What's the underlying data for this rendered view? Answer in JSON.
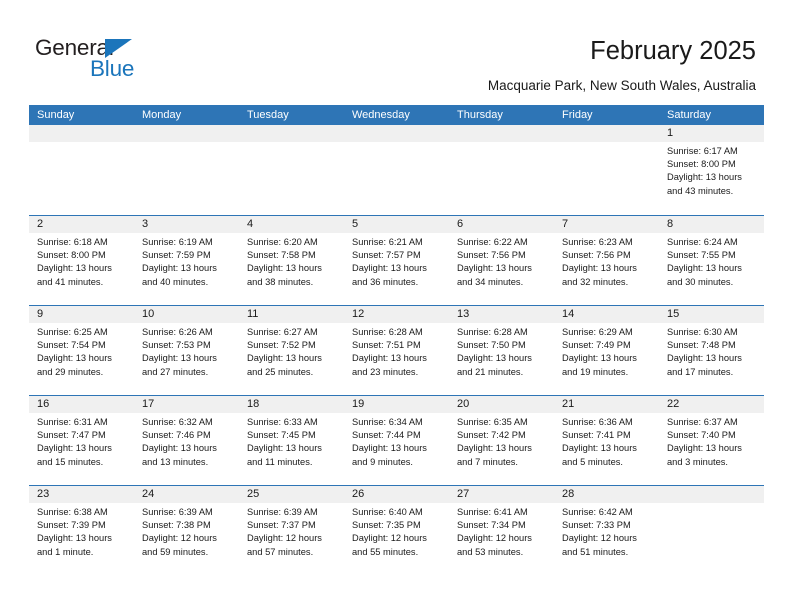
{
  "brand": {
    "name_top": "General",
    "name_bottom": "Blue",
    "triangle_color": "#1b75bb"
  },
  "header": {
    "title": "February 2025",
    "subtitle": "Macquarie Park, New South Wales, Australia"
  },
  "theme": {
    "header_blue": "#2e75b6",
    "band_gray": "#f0f0f0",
    "text": "#1a1a1a"
  },
  "weekdays": [
    "Sunday",
    "Monday",
    "Tuesday",
    "Wednesday",
    "Thursday",
    "Friday",
    "Saturday"
  ],
  "labels": {
    "sunrise": "Sunrise:",
    "sunset": "Sunset:",
    "daylight": "Daylight:"
  },
  "weeks": [
    [
      {
        "day": "",
        "empty": true
      },
      {
        "day": "",
        "empty": true
      },
      {
        "day": "",
        "empty": true
      },
      {
        "day": "",
        "empty": true
      },
      {
        "day": "",
        "empty": true
      },
      {
        "day": "",
        "empty": true
      },
      {
        "day": "1",
        "sunrise": "Sunrise: 6:17 AM",
        "sunset": "Sunset: 8:00 PM",
        "daylight": "Daylight: 13 hours and 43 minutes."
      }
    ],
    [
      {
        "day": "2",
        "sunrise": "Sunrise: 6:18 AM",
        "sunset": "Sunset: 8:00 PM",
        "daylight": "Daylight: 13 hours and 41 minutes."
      },
      {
        "day": "3",
        "sunrise": "Sunrise: 6:19 AM",
        "sunset": "Sunset: 7:59 PM",
        "daylight": "Daylight: 13 hours and 40 minutes."
      },
      {
        "day": "4",
        "sunrise": "Sunrise: 6:20 AM",
        "sunset": "Sunset: 7:58 PM",
        "daylight": "Daylight: 13 hours and 38 minutes."
      },
      {
        "day": "5",
        "sunrise": "Sunrise: 6:21 AM",
        "sunset": "Sunset: 7:57 PM",
        "daylight": "Daylight: 13 hours and 36 minutes."
      },
      {
        "day": "6",
        "sunrise": "Sunrise: 6:22 AM",
        "sunset": "Sunset: 7:56 PM",
        "daylight": "Daylight: 13 hours and 34 minutes."
      },
      {
        "day": "7",
        "sunrise": "Sunrise: 6:23 AM",
        "sunset": "Sunset: 7:56 PM",
        "daylight": "Daylight: 13 hours and 32 minutes."
      },
      {
        "day": "8",
        "sunrise": "Sunrise: 6:24 AM",
        "sunset": "Sunset: 7:55 PM",
        "daylight": "Daylight: 13 hours and 30 minutes."
      }
    ],
    [
      {
        "day": "9",
        "sunrise": "Sunrise: 6:25 AM",
        "sunset": "Sunset: 7:54 PM",
        "daylight": "Daylight: 13 hours and 29 minutes."
      },
      {
        "day": "10",
        "sunrise": "Sunrise: 6:26 AM",
        "sunset": "Sunset: 7:53 PM",
        "daylight": "Daylight: 13 hours and 27 minutes."
      },
      {
        "day": "11",
        "sunrise": "Sunrise: 6:27 AM",
        "sunset": "Sunset: 7:52 PM",
        "daylight": "Daylight: 13 hours and 25 minutes."
      },
      {
        "day": "12",
        "sunrise": "Sunrise: 6:28 AM",
        "sunset": "Sunset: 7:51 PM",
        "daylight": "Daylight: 13 hours and 23 minutes."
      },
      {
        "day": "13",
        "sunrise": "Sunrise: 6:28 AM",
        "sunset": "Sunset: 7:50 PM",
        "daylight": "Daylight: 13 hours and 21 minutes."
      },
      {
        "day": "14",
        "sunrise": "Sunrise: 6:29 AM",
        "sunset": "Sunset: 7:49 PM",
        "daylight": "Daylight: 13 hours and 19 minutes."
      },
      {
        "day": "15",
        "sunrise": "Sunrise: 6:30 AM",
        "sunset": "Sunset: 7:48 PM",
        "daylight": "Daylight: 13 hours and 17 minutes."
      }
    ],
    [
      {
        "day": "16",
        "sunrise": "Sunrise: 6:31 AM",
        "sunset": "Sunset: 7:47 PM",
        "daylight": "Daylight: 13 hours and 15 minutes."
      },
      {
        "day": "17",
        "sunrise": "Sunrise: 6:32 AM",
        "sunset": "Sunset: 7:46 PM",
        "daylight": "Daylight: 13 hours and 13 minutes."
      },
      {
        "day": "18",
        "sunrise": "Sunrise: 6:33 AM",
        "sunset": "Sunset: 7:45 PM",
        "daylight": "Daylight: 13 hours and 11 minutes."
      },
      {
        "day": "19",
        "sunrise": "Sunrise: 6:34 AM",
        "sunset": "Sunset: 7:44 PM",
        "daylight": "Daylight: 13 hours and 9 minutes."
      },
      {
        "day": "20",
        "sunrise": "Sunrise: 6:35 AM",
        "sunset": "Sunset: 7:42 PM",
        "daylight": "Daylight: 13 hours and 7 minutes."
      },
      {
        "day": "21",
        "sunrise": "Sunrise: 6:36 AM",
        "sunset": "Sunset: 7:41 PM",
        "daylight": "Daylight: 13 hours and 5 minutes."
      },
      {
        "day": "22",
        "sunrise": "Sunrise: 6:37 AM",
        "sunset": "Sunset: 7:40 PM",
        "daylight": "Daylight: 13 hours and 3 minutes."
      }
    ],
    [
      {
        "day": "23",
        "sunrise": "Sunrise: 6:38 AM",
        "sunset": "Sunset: 7:39 PM",
        "daylight": "Daylight: 13 hours and 1 minute."
      },
      {
        "day": "24",
        "sunrise": "Sunrise: 6:39 AM",
        "sunset": "Sunset: 7:38 PM",
        "daylight": "Daylight: 12 hours and 59 minutes."
      },
      {
        "day": "25",
        "sunrise": "Sunrise: 6:39 AM",
        "sunset": "Sunset: 7:37 PM",
        "daylight": "Daylight: 12 hours and 57 minutes."
      },
      {
        "day": "26",
        "sunrise": "Sunrise: 6:40 AM",
        "sunset": "Sunset: 7:35 PM",
        "daylight": "Daylight: 12 hours and 55 minutes."
      },
      {
        "day": "27",
        "sunrise": "Sunrise: 6:41 AM",
        "sunset": "Sunset: 7:34 PM",
        "daylight": "Daylight: 12 hours and 53 minutes."
      },
      {
        "day": "28",
        "sunrise": "Sunrise: 6:42 AM",
        "sunset": "Sunset: 7:33 PM",
        "daylight": "Daylight: 12 hours and 51 minutes."
      },
      {
        "day": "",
        "empty": true
      }
    ]
  ]
}
